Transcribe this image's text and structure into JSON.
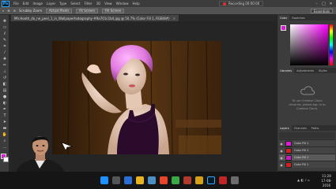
{
  "menubar": {
    "logo": "Ps",
    "items": [
      "File",
      "Edit",
      "Image",
      "Layer",
      "Type",
      "Select",
      "Filter",
      "3D",
      "View",
      "Window",
      "Help"
    ],
    "recording_label": "Recording 00:00:00"
  },
  "options": {
    "fields": [
      "Scrubby Zoom",
      "Actual Pixels",
      "Fit Screen",
      "Fill Screen"
    ],
    "workspace": "Essentials"
  },
  "document": {
    "tab_title": "Mh.Hooth_do_ne_peel_1_in_Wallpaperhotography-#9a701c1b4.jpg @ 50.7% (Color Fill 1, RGB/8#)",
    "close": "×"
  },
  "panels": {
    "top_tabs": [
      "Color",
      "Swatches"
    ],
    "mid_tabs": [
      "Libraries",
      "Adjustments",
      "Styles"
    ],
    "cc_message": "To use Creative Cloud Libraries, please sign in to Creative Cloud.",
    "layer_tabs": [
      "Layers",
      "Channels",
      "Paths"
    ],
    "layers": [
      {
        "name": "Color Fill 1",
        "thumb": "#d81ed2"
      },
      {
        "name": "Color Fill 1",
        "thumb": "#cc2222"
      },
      {
        "name": "Color Fill 1",
        "thumb": "#c21fb9"
      },
      {
        "name": "Color Fill 1",
        "thumb": "#cc2222"
      }
    ]
  },
  "colors": {
    "foreground": "#d81ed2",
    "background": "#ffffff"
  },
  "taskbar": {
    "time": "11:28",
    "date": "17-08-2016"
  }
}
